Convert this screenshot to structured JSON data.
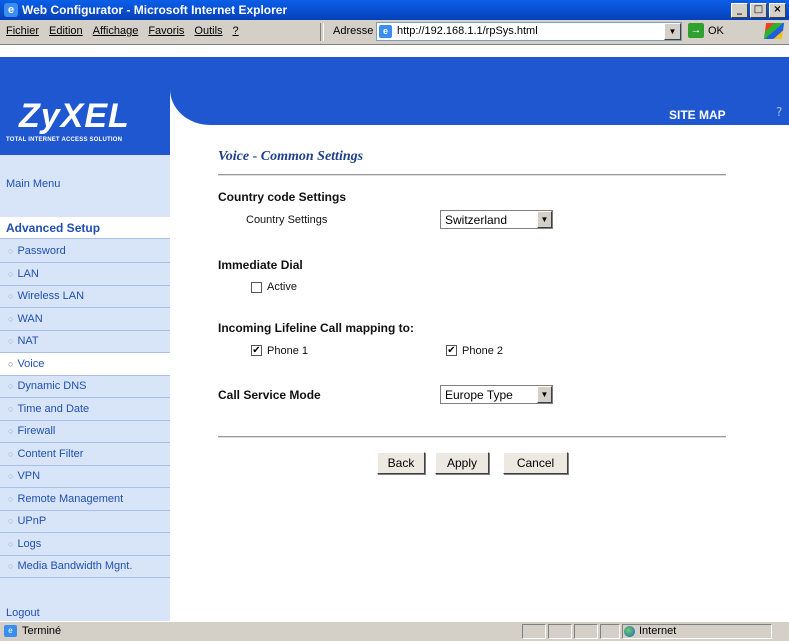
{
  "window": {
    "title": "Web Configurator - Microsoft Internet Explorer",
    "minimize": "_",
    "maximize": "□",
    "close": "×"
  },
  "menubar": {
    "items": [
      {
        "label": "Fichier"
      },
      {
        "label": "Edition"
      },
      {
        "label": "Affichage"
      },
      {
        "label": "Favoris"
      },
      {
        "label": "Outils"
      },
      {
        "label": "?"
      }
    ],
    "address_label": "Adresse",
    "address_url": "http://192.168.1.1/rpSys.html",
    "go_label": "OK"
  },
  "header": {
    "logo": "ZyXEL",
    "tagline": "TOTAL INTERNET ACCESS SOLUTION",
    "site_map": "SITE MAP"
  },
  "sidebar": {
    "main_menu": "Main Menu",
    "advanced_setup": "Advanced Setup",
    "items": [
      {
        "label": "Password"
      },
      {
        "label": "LAN"
      },
      {
        "label": "Wireless LAN"
      },
      {
        "label": "WAN"
      },
      {
        "label": "NAT"
      },
      {
        "label": "Voice"
      },
      {
        "label": "Dynamic DNS"
      },
      {
        "label": "Time and Date"
      },
      {
        "label": "Firewall"
      },
      {
        "label": "Content Filter"
      },
      {
        "label": "VPN"
      },
      {
        "label": "Remote Management"
      },
      {
        "label": "UPnP"
      },
      {
        "label": "Logs"
      },
      {
        "label": "Media Bandwidth Mgnt."
      }
    ],
    "selected": "Voice",
    "logout": "Logout"
  },
  "main": {
    "title": "Voice - Common Settings",
    "country_section": "Country code Settings",
    "country_label": "Country Settings",
    "country_value": "Switzerland",
    "immediate_section": "Immediate Dial",
    "active_label": "Active",
    "active_checked": false,
    "lifeline_section": "Incoming Lifeline Call mapping to:",
    "phone1_label": "Phone 1",
    "phone1_checked": true,
    "phone2_label": "Phone 2",
    "phone2_checked": true,
    "service_section": "Call Service Mode",
    "service_value": "Europe Type",
    "back_label": "Back",
    "apply_label": "Apply",
    "cancel_label": "Cancel"
  },
  "statusbar": {
    "status": "Terminé",
    "zone": "Internet"
  },
  "icons": {
    "checked_glyph": "✔",
    "dropdown_glyph": "▼",
    "radio_glyph": "○"
  },
  "colors": {
    "brand_blue": "#1e57cf",
    "sidebar_bg": "#d8e5f8",
    "link_blue": "#1f4fb2"
  }
}
